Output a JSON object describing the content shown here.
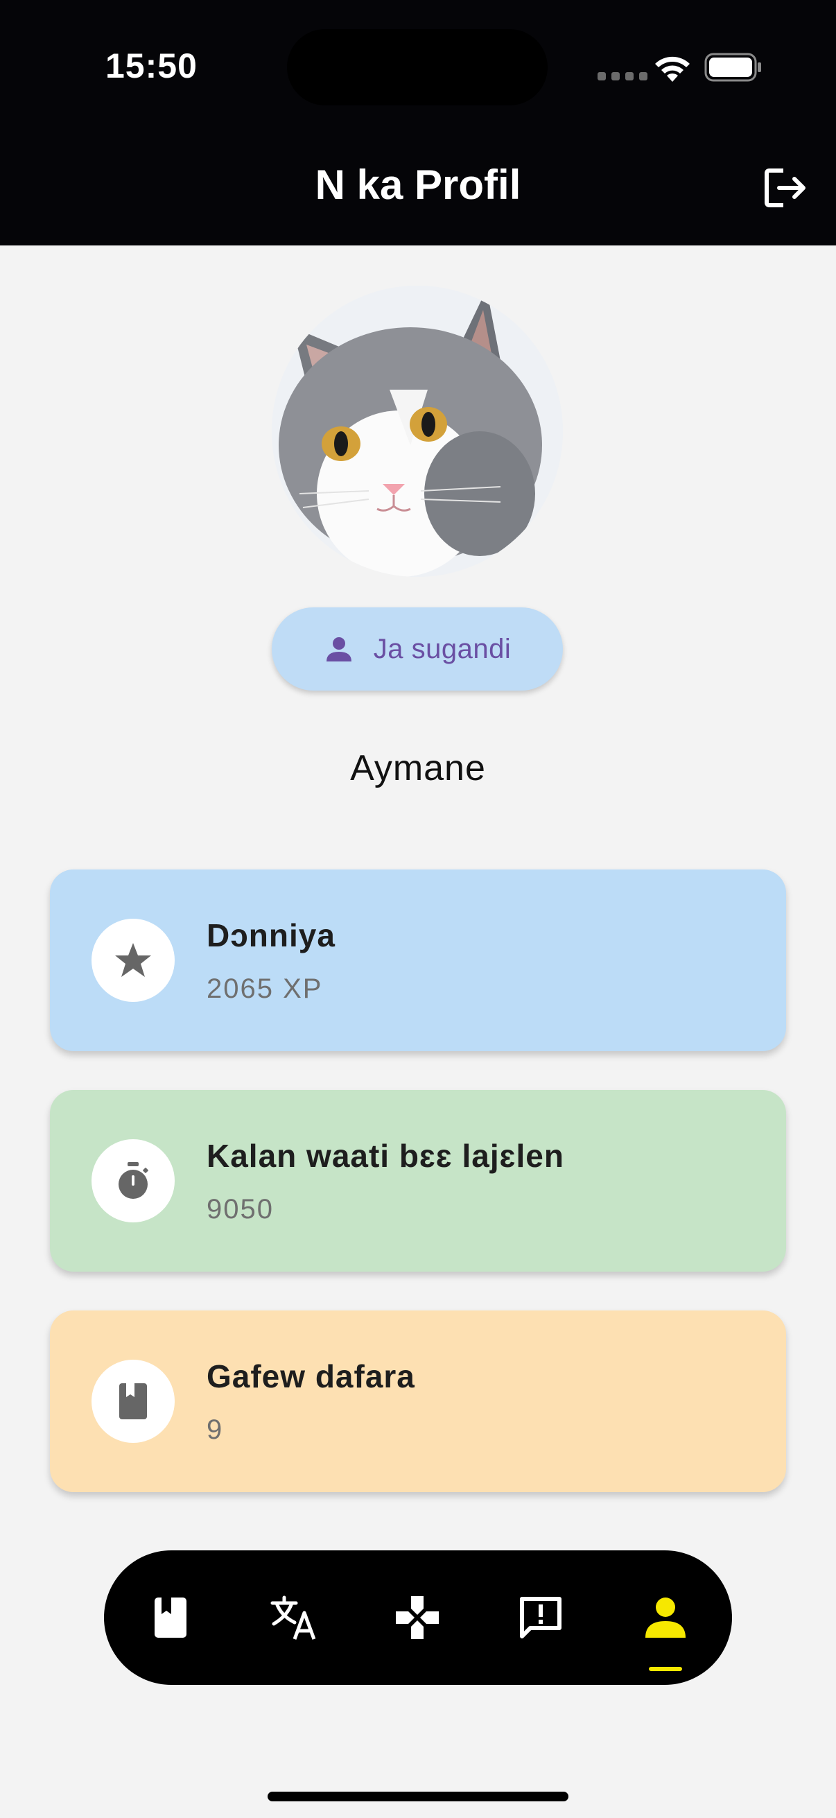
{
  "status_bar": {
    "time": "15:50"
  },
  "header": {
    "title": "N ka Profil",
    "logout_icon": "logout-icon"
  },
  "profile": {
    "change_photo_label": "Ja sugandi",
    "username": "Aymane"
  },
  "stats": [
    {
      "title": "Dɔnniya",
      "value": "2065 XP",
      "icon": "star-icon",
      "color": "#bcdcf7"
    },
    {
      "title": "Kalan waati bɛɛ lajɛlen",
      "value": "9050",
      "icon": "stopwatch-icon",
      "color": "#c6e4c7"
    },
    {
      "title": "Gafew dafara",
      "value": "9",
      "icon": "book-icon",
      "color": "#fde0b2"
    }
  ],
  "bottom_nav": {
    "items": [
      "book-icon",
      "translate-icon",
      "gamepad-icon",
      "feedback-icon",
      "person-icon"
    ],
    "active_index": 4,
    "active_color": "#f6e800"
  }
}
